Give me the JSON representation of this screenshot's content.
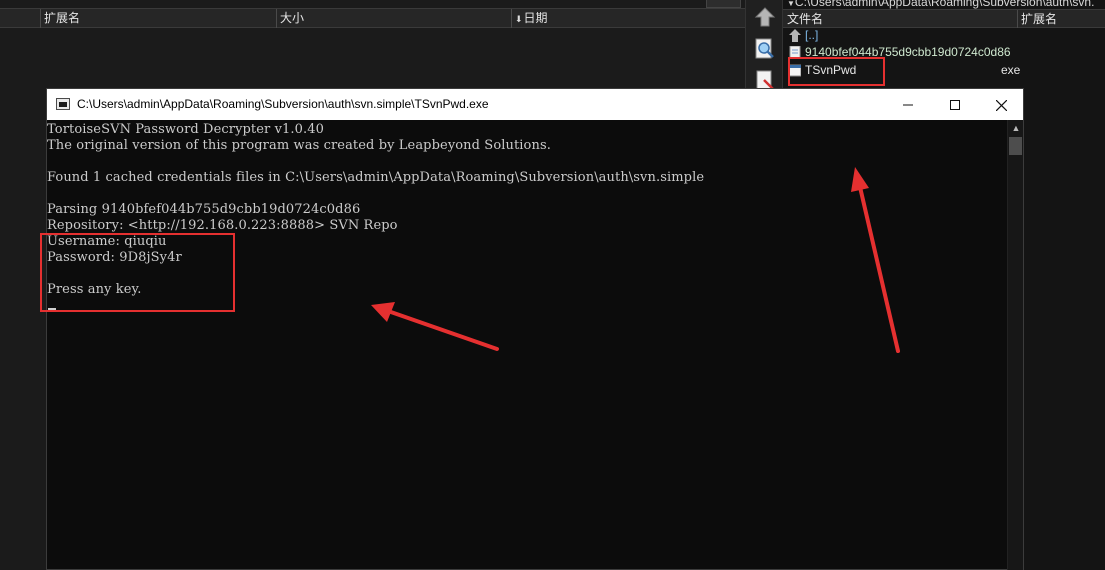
{
  "left_pane": {
    "columns": [
      "扩展名",
      "大小",
      "日期"
    ]
  },
  "right_pane": {
    "path": "C:\\Users\\admin\\AppData\\Roaming\\Subversion\\auth\\svn.",
    "columns": [
      "文件名",
      "扩展名"
    ],
    "files": [
      {
        "name": "[..]",
        "ext": "",
        "icon": "up-dir-icon"
      },
      {
        "name": "9140bfef044b755d9cbb19d0724c0d86",
        "ext": "",
        "icon": "file-icon"
      },
      {
        "name": "TSvnPwd",
        "ext": "exe",
        "icon": "exe-icon"
      }
    ]
  },
  "console": {
    "title": "C:\\Users\\admin\\AppData\\Roaming\\Subversion\\auth\\svn.simple\\TSvnPwd.exe",
    "lines": [
      "TortoiseSVN Password Decrypter v1.0.40",
      "The original version of this program was created by Leapbeyond Solutions.",
      "",
      "Found 1 cached credentials files in C:\\Users\\admin\\AppData\\Roaming\\Subversion\\auth\\svn.simple",
      "",
      "Parsing 9140bfef044b755d9cbb19d0724c0d86",
      "Repository: <http://192.168.0.223:8888> SVN Repo",
      "Username: qiuqiu",
      "Password: 9D8jSy4r",
      "",
      "Press any key."
    ]
  },
  "colors": {
    "annotation": "#e53030",
    "console_bg": "#0c0c0c",
    "console_text": "#cccccc"
  }
}
